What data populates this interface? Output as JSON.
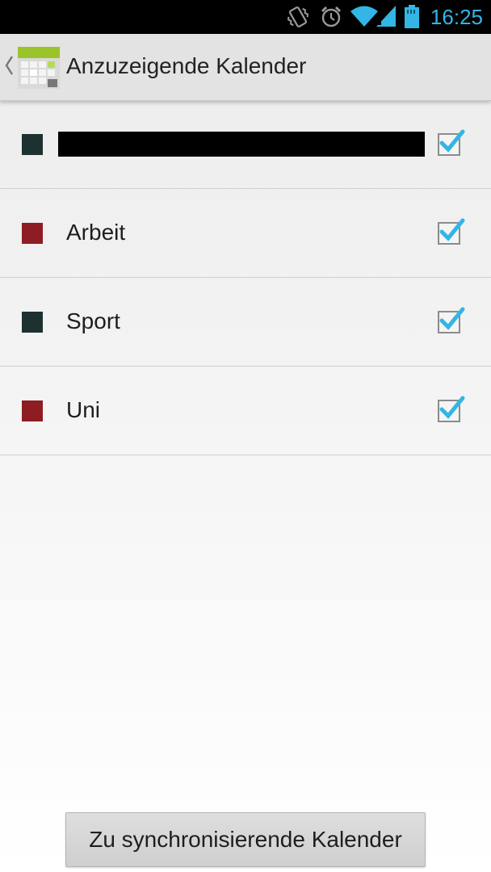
{
  "status_bar": {
    "time": "16:25",
    "icons": [
      "vibrate-icon",
      "alarm-icon",
      "wifi-icon",
      "signal-icon",
      "battery-icon"
    ],
    "accent_color": "#33b5e5"
  },
  "action_bar": {
    "title": "Anzuzeigende Kalender",
    "up_icon": "chevron-left-icon",
    "app_icon": "calendar-app-icon"
  },
  "calendars": [
    {
      "name": "",
      "color": "#1d3230",
      "checked": true,
      "redacted": true
    },
    {
      "name": "Arbeit",
      "color": "#8d1d22",
      "checked": true
    },
    {
      "name": "Sport",
      "color": "#1d3230",
      "checked": true
    },
    {
      "name": "Uni",
      "color": "#8d1d22",
      "checked": true
    }
  ],
  "footer": {
    "sync_button_label": "Zu synchronisierende Kalender"
  },
  "colors": {
    "checkmark": "#33b5e5",
    "checkbox_border": "#8c8c8c"
  }
}
